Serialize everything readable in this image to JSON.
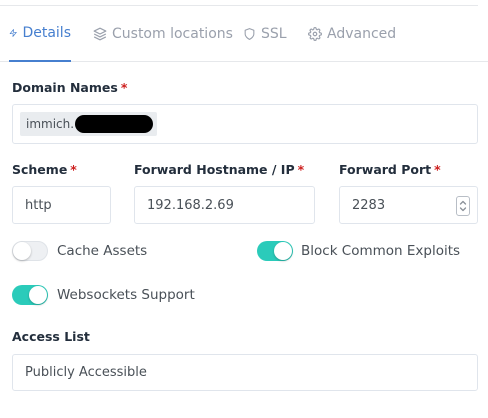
{
  "tabs": {
    "details": "Details",
    "custom_locations": "Custom locations",
    "ssl": "SSL",
    "advanced": "Advanced"
  },
  "domain_names": {
    "label": "Domain Names",
    "required_mark": "*",
    "chip_text": "immich."
  },
  "scheme": {
    "label": "Scheme",
    "required_mark": "*",
    "value": "http"
  },
  "forward_hostname": {
    "label": "Forward Hostname / IP",
    "required_mark": "*",
    "value": "192.168.2.69"
  },
  "forward_port": {
    "label": "Forward Port",
    "required_mark": "*",
    "value": "2283"
  },
  "toggles": {
    "cache_assets": {
      "label": "Cache Assets",
      "checked": false
    },
    "block_common_exploits": {
      "label": "Block Common Exploits",
      "checked": true
    },
    "websockets_support": {
      "label": "Websockets Support",
      "checked": true
    }
  },
  "access_list": {
    "label": "Access List",
    "value": "Publicly Accessible"
  },
  "colors": {
    "accent": "#467fcf",
    "toggle_on": "#2bcbba",
    "required": "#cd201f"
  }
}
